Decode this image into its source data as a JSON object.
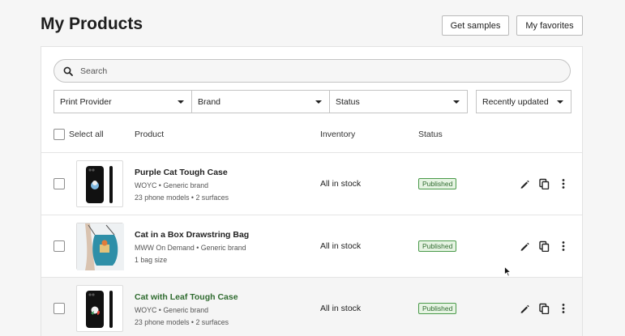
{
  "header": {
    "title": "My Products",
    "get_samples_label": "Get samples",
    "my_favorites_label": "My favorites"
  },
  "search": {
    "placeholder": "Search"
  },
  "filters": {
    "print_provider": "Print Provider",
    "brand": "Brand",
    "status": "Status",
    "sort": "Recently updated"
  },
  "table": {
    "select_all": "Select all",
    "columns": {
      "product": "Product",
      "inventory": "Inventory",
      "status": "Status"
    },
    "rows": [
      {
        "name": "Purple Cat Tough Case",
        "meta1": "WOYC • Generic brand",
        "meta2": "23 phone models • 2 surfaces",
        "inventory": "All in stock",
        "status": "Published"
      },
      {
        "name": "Cat in a Box Drawstring Bag",
        "meta1": "MWW On Demand • Generic brand",
        "meta2": "1 bag size",
        "inventory": "All in stock",
        "status": "Published"
      },
      {
        "name": "Cat with Leaf Tough Case",
        "meta1": "WOYC • Generic brand",
        "meta2": "23 phone models • 2 surfaces",
        "inventory": "All in stock",
        "status": "Published"
      }
    ]
  },
  "colors": {
    "accent_green": "#2f6b2f",
    "badge_bg": "#e6f4e3",
    "hover_row": "#f5f5f5"
  }
}
